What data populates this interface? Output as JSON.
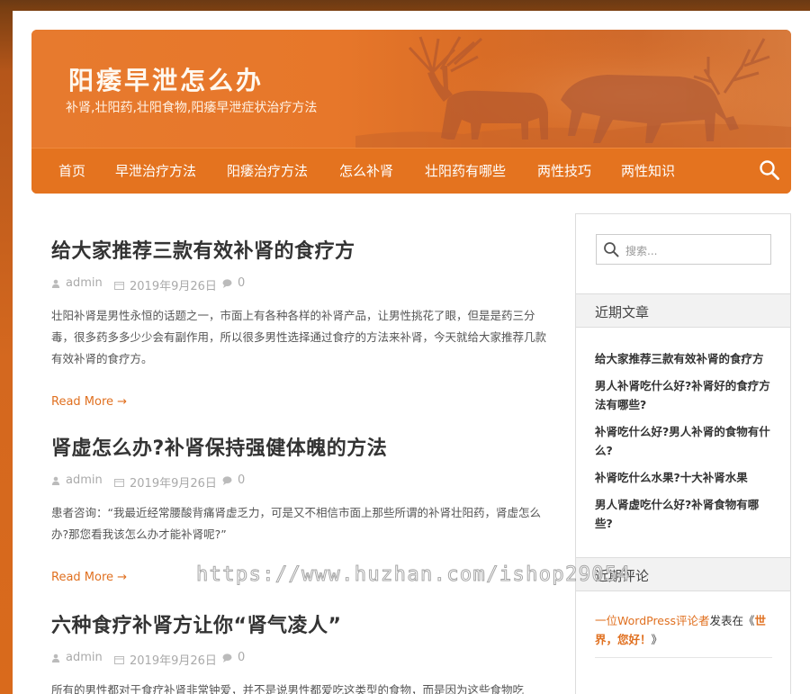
{
  "site": {
    "title": "阳痿早泄怎么办",
    "description": "补肾,壮阳药,壮阳食物,阳痿早泄症状治疗方法"
  },
  "nav": {
    "items": [
      "首页",
      "早泄治疗方法",
      "阳痿治疗方法",
      "怎么补肾",
      "壮阳药有哪些",
      "两性技巧",
      "两性知识"
    ]
  },
  "posts": [
    {
      "title": "给大家推荐三款有效补肾的食疗方",
      "author": "admin",
      "date": "2019年9月26日",
      "comments": "0",
      "excerpt": "壮阳补肾是男性永恒的话题之一，市面上有各种各样的补肾产品，让男性挑花了眼，但是是药三分毒，很多药多多少少会有副作用，所以很多男性选择通过食疗的方法来补肾，今天就给大家推荐几款有效补肾的食疗方。",
      "read_more": "Read More"
    },
    {
      "title": "肾虚怎么办?补肾保持强健体魄的方法",
      "author": "admin",
      "date": "2019年9月26日",
      "comments": "0",
      "excerpt": "患者咨询：“我最近经常腰酸背痛肾虚乏力，可是又不相信市面上那些所谓的补肾壮阳药，肾虚怎么办?那您看我该怎么办才能补肾呢?”",
      "read_more": "Read More"
    },
    {
      "title": "六种食疗补肾方让你“肾气凌人”",
      "author": "admin",
      "date": "2019年9月26日",
      "comments": "0",
      "excerpt": "所有的男性都对于食疗补肾非常钟爱，并不是说男性都爱吃这类型的食物，而是因为这些食物吃"
    }
  ],
  "sidebar": {
    "search_placeholder": "搜索...",
    "recent_title": "近期文章",
    "recent_posts": [
      "给大家推荐三款有效补肾的食疗方",
      "男人补肾吃什么好?补肾好的食疗方法有哪些?",
      "补肾吃什么好?男人补肾的食物有什么?",
      "补肾吃什么水果?十大补肾水果",
      "男人肾虚吃什么好?补肾食物有哪些?"
    ],
    "comments_title": "近期评论",
    "comment": {
      "author": "一位WordPress评论者",
      "middle": "发表在《",
      "post": "世界，您好！",
      "end": "》"
    }
  },
  "watermark": "https://www.huzhan.com/ishop29054",
  "colors": {
    "accent": "#e4731f",
    "link": "#e07020"
  }
}
